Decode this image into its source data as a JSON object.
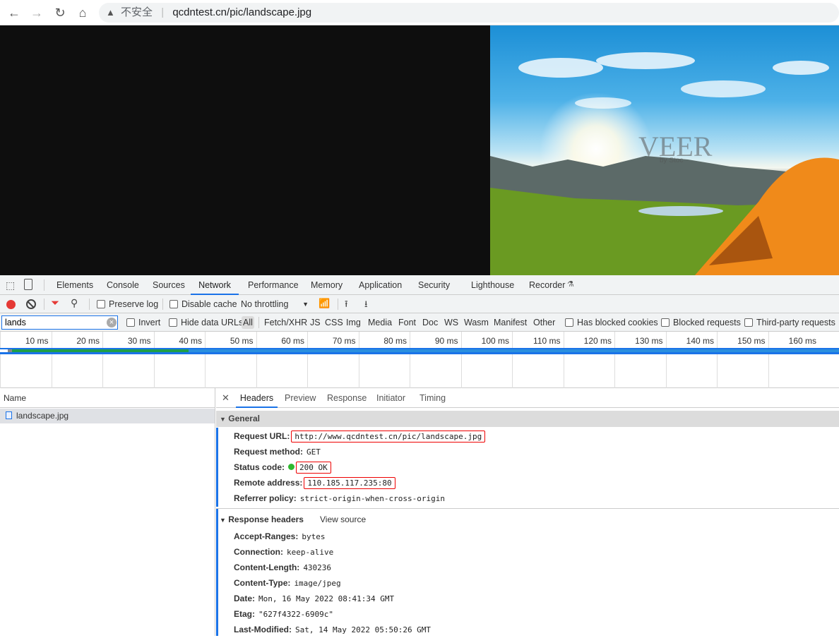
{
  "browser": {
    "insecure_label": "不安全",
    "url": "qcdntest.cn/pic/landscape.jpg"
  },
  "photo": {
    "watermark": "VEER",
    "watermark_sub": "by Stoc"
  },
  "devtools": {
    "tabs": [
      "Elements",
      "Console",
      "Sources",
      "Network",
      "Performance",
      "Memory",
      "Application",
      "Security",
      "Lighthouse",
      "Recorder"
    ],
    "active_tab": "Network",
    "toolbar": {
      "preserve_log": "Preserve log",
      "disable_cache": "Disable cache",
      "throttling": "No throttling"
    },
    "filter": {
      "value": "lands",
      "invert": "Invert",
      "hide_data_urls": "Hide data URLs",
      "types": [
        "All",
        "Fetch/XHR",
        "JS",
        "CSS",
        "Img",
        "Media",
        "Font",
        "Doc",
        "WS",
        "Wasm",
        "Manifest",
        "Other"
      ],
      "has_blocked_cookies": "Has blocked cookies",
      "blocked_requests": "Blocked requests",
      "third_party": "Third-party requests"
    },
    "timeline": {
      "ticks": [
        "10 ms",
        "20 ms",
        "30 ms",
        "40 ms",
        "50 ms",
        "60 ms",
        "70 ms",
        "80 ms",
        "90 ms",
        "100 ms",
        "110 ms",
        "120 ms",
        "130 ms",
        "140 ms",
        "150 ms",
        "160 ms"
      ]
    },
    "requests": {
      "column": "Name",
      "items": [
        {
          "name": "landscape.jpg"
        }
      ]
    },
    "detail": {
      "tabs": [
        "Headers",
        "Preview",
        "Response",
        "Initiator",
        "Timing"
      ],
      "general_title": "General",
      "general": [
        {
          "key": "Request URL:",
          "value": "http://www.qcdntest.cn/pic/landscape.jpg",
          "boxed": true
        },
        {
          "key": "Request method:",
          "value": "GET"
        },
        {
          "key": "Status code:",
          "value": "200 OK",
          "boxed": true
        },
        {
          "key": "Remote address:",
          "value": "110.185.117.235:80",
          "boxed": true
        },
        {
          "key": "Referrer policy:",
          "value": "strict-origin-when-cross-origin"
        }
      ],
      "response_title": "Response headers",
      "view_source": "View source",
      "response": [
        {
          "key": "Accept-Ranges:",
          "value": "bytes"
        },
        {
          "key": "Connection:",
          "value": "keep-alive"
        },
        {
          "key": "Content-Length:",
          "value": "430236"
        },
        {
          "key": "Content-Type:",
          "value": "image/jpeg"
        },
        {
          "key": "Date:",
          "value": "Mon, 16 May 2022 08:41:34 GMT"
        },
        {
          "key": "Etag:",
          "value": "\"627f4322-6909c\""
        },
        {
          "key": "Last-Modified:",
          "value": "Sat, 14 May 2022 05:50:26 GMT"
        }
      ]
    }
  },
  "colors": {
    "accent": "#1a73e8",
    "record": "#e53935",
    "highlight": "#e00000",
    "status_ok": "#2fb82f"
  }
}
